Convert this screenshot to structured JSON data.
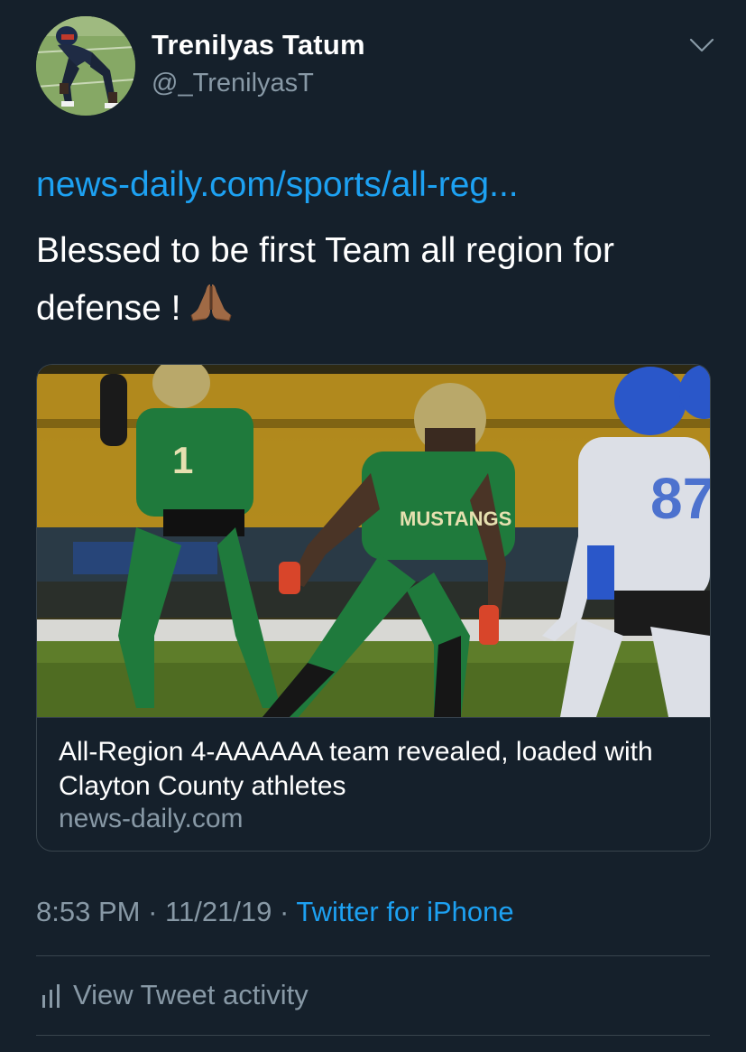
{
  "tweet": {
    "author": {
      "display_name": "Trenilyas Tatum",
      "handle": "@_TrenilyasT"
    },
    "link_text": "news-daily.com/sports/all-reg...",
    "text": "Blessed to be first Team all region for defense !",
    "emoji": "folded-hands-icon",
    "card": {
      "title": "All-Region 4-AAAAAA team revealed, loaded with Clayton County athletes",
      "domain": "news-daily.com"
    },
    "time": "8:53 PM",
    "separator": "·",
    "date": "11/21/19",
    "source": "Twitter for iPhone",
    "activity_label": "View Tweet activity"
  },
  "colors": {
    "background": "#15202b",
    "text": "#ffffff",
    "secondary_text": "#8899a6",
    "link": "#1da1f2",
    "border": "#38444d"
  },
  "icons": {
    "menu": "chevron-down-icon",
    "activity": "bar-chart-icon"
  }
}
